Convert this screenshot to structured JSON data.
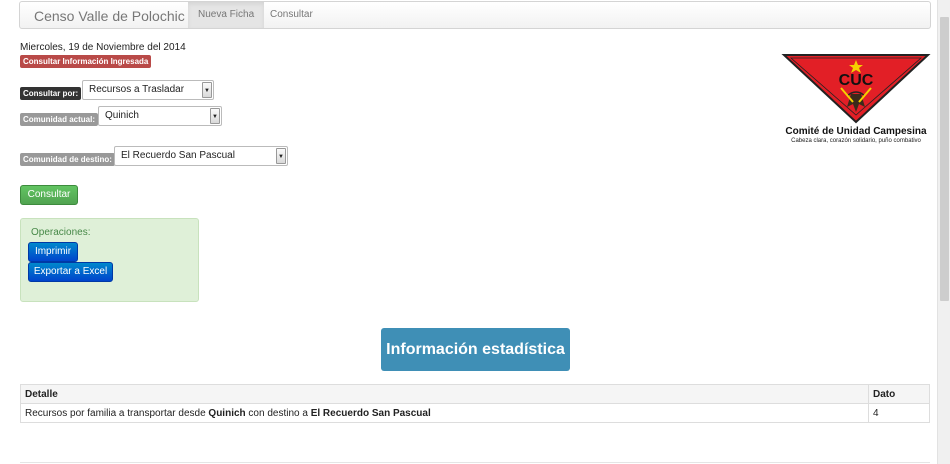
{
  "navbar": {
    "brand": "Censo Valle de Polochic",
    "tabs": [
      {
        "label": "Nueva Ficha",
        "active": true
      },
      {
        "label": "Consultar",
        "active": false
      }
    ]
  },
  "date_text": "Miercoles, 19 de Noviembre del 2014",
  "consult_badge": "Consultar Información Ingresada",
  "filters": {
    "consultar_por": {
      "label": "Consultar por:",
      "value": "Recursos a Trasladar"
    },
    "comunidad_actual": {
      "label": "Comunidad actual:",
      "value": "Quinich"
    },
    "comunidad_destino": {
      "label": "Comunidad de destino:",
      "value": "El Recuerdo San Pascual"
    }
  },
  "consult_button": "Consultar",
  "operations": {
    "title": "Operaciones:",
    "print_button": "Imprimir",
    "export_button": "Exportar a Excel"
  },
  "logo": {
    "letters": "CUC",
    "name": "Comité de Unidad Campesina",
    "motto": "Cabeza clara, corazón solidario, puño combativo"
  },
  "stats_heading": "Información estadística",
  "table": {
    "headers": [
      "Detalle",
      "Dato"
    ],
    "rows": [
      {
        "prefix": "Recursos por familia a transportar desde ",
        "origin": "Quinich",
        "middle": " con destino a ",
        "destination": "El Recuerdo San Pascual",
        "value": "4"
      }
    ]
  },
  "colors": {
    "danger": "#b94a48",
    "success": "#51a351",
    "primary": "#0044cc",
    "stats": "#3f8fb6",
    "ops_bg": "#dff0d8",
    "logo_red": "#e21f26"
  }
}
